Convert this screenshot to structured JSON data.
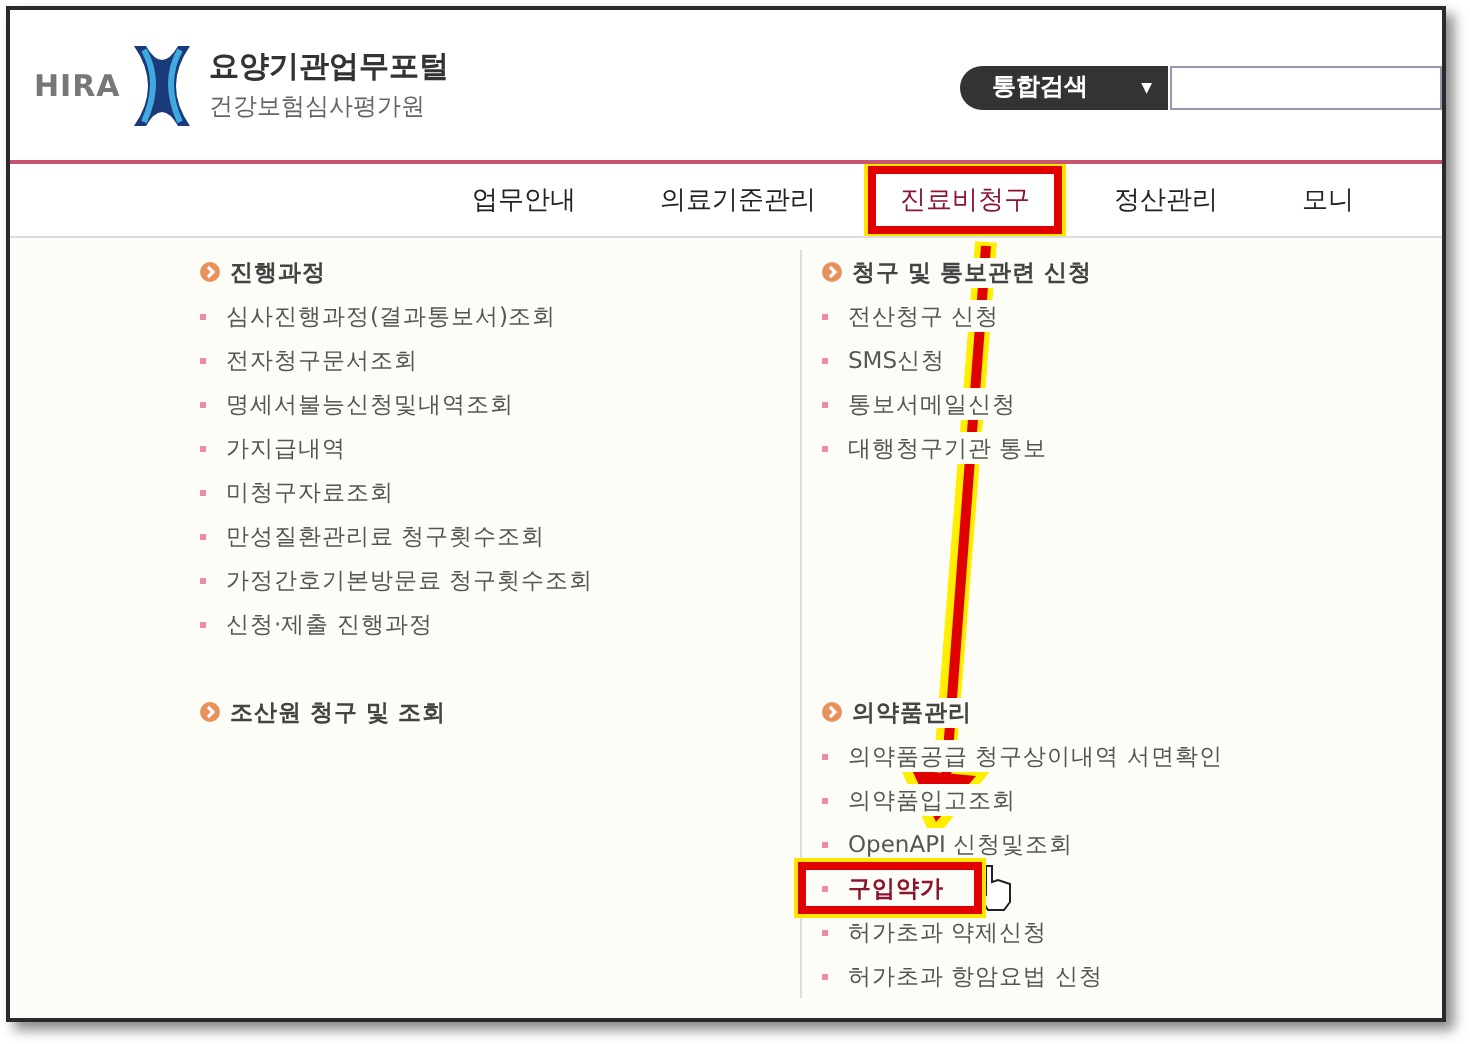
{
  "header": {
    "brand": "HIRA",
    "title": "요양기관업무포털",
    "subtitle": "건강보험심사평가원",
    "search": {
      "scope": "통합검색",
      "caret": "▼"
    }
  },
  "nav": [
    {
      "label": "업무안내",
      "selected": false
    },
    {
      "label": "의료기준관리",
      "selected": false
    },
    {
      "label": "진료비청구",
      "selected": true
    },
    {
      "label": "정산관리",
      "selected": false
    },
    {
      "label": "모니",
      "selected": false
    }
  ],
  "menu": {
    "columns": [
      [
        {
          "heading": "진행과정",
          "items": [
            {
              "label": "심사진행과정(결과통보서)조회",
              "selected": false
            },
            {
              "label": "전자청구문서조회",
              "selected": false
            },
            {
              "label": "명세서불능신청및내역조회",
              "selected": false
            },
            {
              "label": "가지급내역",
              "selected": false
            },
            {
              "label": "미청구자료조회",
              "selected": false
            },
            {
              "label": "만성질환관리료 청구횟수조회",
              "selected": false
            },
            {
              "label": "가정간호기본방문료 청구횟수조회",
              "selected": false
            },
            {
              "label": "신청·제출 진행과정",
              "selected": false
            }
          ]
        },
        {
          "heading": "조산원 청구 및 조회"
        }
      ],
      [
        {
          "heading": "청구 및 통보관련 신청",
          "items": [
            {
              "label": "전산청구 신청",
              "selected": false
            },
            {
              "label": "SMS신청",
              "selected": false
            },
            {
              "label": "통보서메일신청",
              "selected": false
            },
            {
              "label": "대행청구기관 통보",
              "selected": false
            }
          ]
        },
        {
          "heading": "의약품관리",
          "items": [
            {
              "label": "의약품공급 청구상이내역 서면확인",
              "selected": false
            },
            {
              "label": "의약품입고조회",
              "selected": false
            },
            {
              "label": "OpenAPI 신청및조회",
              "selected": false
            },
            {
              "label": "구입약가",
              "selected": true
            },
            {
              "label": "허가초과 약제신청",
              "selected": false
            },
            {
              "label": "허가초과 항암요법 신청",
              "selected": false
            }
          ]
        }
      ]
    ]
  }
}
